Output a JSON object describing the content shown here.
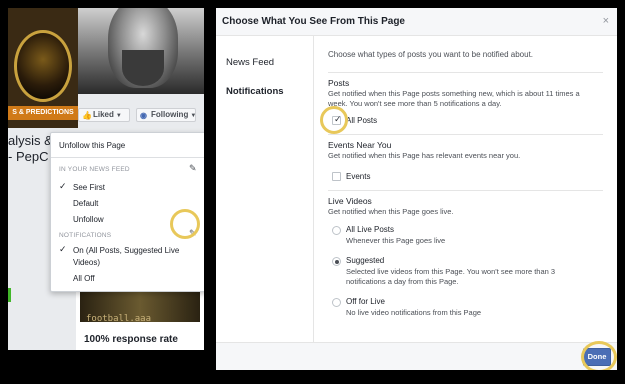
{
  "left_page": {
    "logo_banner": "S & PREDICTIONS",
    "liked_label": "Liked",
    "following_label": "Following",
    "page_title_line1": "alysis &",
    "page_title_line2": "- PepC",
    "thumb_text": "football.aaa",
    "response_rate": "100% response rate",
    "dropdown": {
      "unfollow": "Unfollow this Page",
      "section_news_feed": "IN YOUR NEWS FEED",
      "see_first": "See First",
      "default": "Default",
      "unfollow_feed": "Unfollow",
      "section_notifications": "NOTIFICATIONS",
      "notif_on_line1": "On (All Posts, Suggested Live",
      "notif_on_line2": "Videos)",
      "all_off": "All Off"
    }
  },
  "dialog": {
    "title": "Choose What You See From This Page",
    "close": "×",
    "nav": [
      {
        "label": "News Feed"
      },
      {
        "label": "Notifications"
      }
    ],
    "lead": "Choose what types of posts you want to be notified about.",
    "posts": {
      "heading": "Posts",
      "desc": "Get notified when this Page posts something new, which is about 11 times a week. You won't see more than 5 notifications a day.",
      "option": "All Posts",
      "checked": true
    },
    "events": {
      "heading": "Events Near You",
      "desc": "Get notified when this Page has relevant events near you.",
      "option": "Events",
      "checked": false
    },
    "live": {
      "heading": "Live Videos",
      "desc": "Get notified when this Page goes live.",
      "options": [
        {
          "title": "All Live Posts",
          "desc": "Whenever this Page goes live",
          "selected": false
        },
        {
          "title": "Suggested",
          "desc": "Selected live videos from this Page. You won't see more than 3 notifications a day from this Page.",
          "selected": true
        },
        {
          "title": "Off for Live",
          "desc": "No live video notifications from this Page",
          "selected": false
        }
      ]
    },
    "done": "Done"
  }
}
